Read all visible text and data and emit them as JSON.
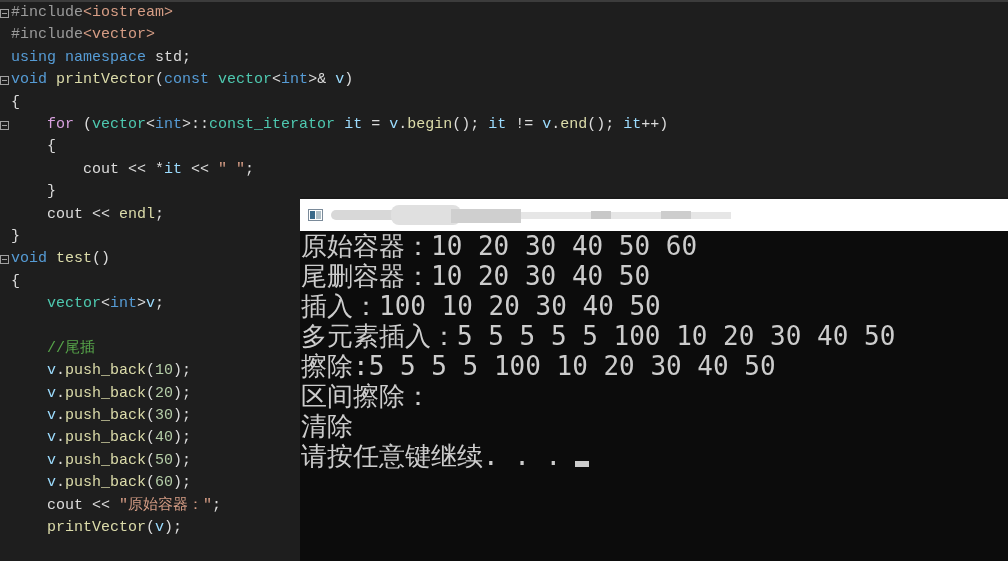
{
  "editor": {
    "lines": [
      {
        "fold": true,
        "tokens": [
          {
            "kind": "pp",
            "text": "#include"
          },
          {
            "kind": "str",
            "text": "<iostream>"
          }
        ]
      },
      {
        "fold": false,
        "tokens": [
          {
            "kind": "pp",
            "text": "#include"
          },
          {
            "kind": "str",
            "text": "<vector>"
          }
        ]
      },
      {
        "fold": false,
        "tokens": [
          {
            "kind": "kw",
            "text": "using "
          },
          {
            "kind": "kw",
            "text": "namespace "
          },
          {
            "kind": "plain",
            "text": "std;"
          }
        ]
      },
      {
        "fold": true,
        "tokens": [
          {
            "kind": "kw",
            "text": "void "
          },
          {
            "kind": "fn",
            "text": "printVector"
          },
          {
            "kind": "plain",
            "text": "("
          },
          {
            "kind": "kw",
            "text": "const "
          },
          {
            "kind": "type",
            "text": "vector"
          },
          {
            "kind": "plain",
            "text": "<"
          },
          {
            "kind": "kw",
            "text": "int"
          },
          {
            "kind": "plain",
            "text": ">& "
          },
          {
            "kind": "var",
            "text": "v"
          },
          {
            "kind": "plain",
            "text": ")"
          }
        ]
      },
      {
        "fold": false,
        "tokens": [
          {
            "kind": "plain",
            "text": "{"
          }
        ]
      },
      {
        "fold": true,
        "tokens": [
          {
            "kind": "ctrl",
            "text": "    for"
          },
          {
            "kind": "plain",
            "text": " ("
          },
          {
            "kind": "type",
            "text": "vector"
          },
          {
            "kind": "plain",
            "text": "<"
          },
          {
            "kind": "kw",
            "text": "int"
          },
          {
            "kind": "plain",
            "text": ">::"
          },
          {
            "kind": "type",
            "text": "const_iterator "
          },
          {
            "kind": "var",
            "text": "it"
          },
          {
            "kind": "plain",
            "text": " = "
          },
          {
            "kind": "var",
            "text": "v"
          },
          {
            "kind": "plain",
            "text": "."
          },
          {
            "kind": "fn",
            "text": "begin"
          },
          {
            "kind": "plain",
            "text": "(); "
          },
          {
            "kind": "var",
            "text": "it"
          },
          {
            "kind": "plain",
            "text": " != "
          },
          {
            "kind": "var",
            "text": "v"
          },
          {
            "kind": "plain",
            "text": "."
          },
          {
            "kind": "fn",
            "text": "end"
          },
          {
            "kind": "plain",
            "text": "(); "
          },
          {
            "kind": "var",
            "text": "it"
          },
          {
            "kind": "plain",
            "text": "++)"
          }
        ]
      },
      {
        "fold": false,
        "tokens": [
          {
            "kind": "plain",
            "text": "    {"
          }
        ]
      },
      {
        "fold": false,
        "tokens": [
          {
            "kind": "plain",
            "text": "        cout << *"
          },
          {
            "kind": "var",
            "text": "it"
          },
          {
            "kind": "plain",
            "text": " << "
          },
          {
            "kind": "str",
            "text": "\" \""
          },
          {
            "kind": "plain",
            "text": ";"
          }
        ]
      },
      {
        "fold": false,
        "tokens": [
          {
            "kind": "plain",
            "text": "    }"
          }
        ]
      },
      {
        "fold": false,
        "tokens": [
          {
            "kind": "plain",
            "text": "    cout << "
          },
          {
            "kind": "fn",
            "text": "endl"
          },
          {
            "kind": "plain",
            "text": ";"
          }
        ]
      },
      {
        "fold": false,
        "tokens": [
          {
            "kind": "plain",
            "text": "}"
          }
        ]
      },
      {
        "fold": true,
        "tokens": [
          {
            "kind": "kw",
            "text": "void "
          },
          {
            "kind": "fn",
            "text": "test"
          },
          {
            "kind": "plain",
            "text": "()"
          }
        ]
      },
      {
        "fold": false,
        "tokens": [
          {
            "kind": "plain",
            "text": "{"
          }
        ]
      },
      {
        "fold": false,
        "tokens": [
          {
            "kind": "type",
            "text": "    vector"
          },
          {
            "kind": "plain",
            "text": "<"
          },
          {
            "kind": "kw",
            "text": "int"
          },
          {
            "kind": "plain",
            "text": ">"
          },
          {
            "kind": "var",
            "text": "v"
          },
          {
            "kind": "plain",
            "text": ";"
          }
        ]
      },
      {
        "fold": false
      },
      {
        "fold": false,
        "tokens": [
          {
            "kind": "comment",
            "text": "    //尾插"
          }
        ]
      },
      {
        "fold": false,
        "tokens": [
          {
            "kind": "var",
            "text": "    v"
          },
          {
            "kind": "plain",
            "text": "."
          },
          {
            "kind": "fn",
            "text": "push_back"
          },
          {
            "kind": "plain",
            "text": "("
          },
          {
            "kind": "num",
            "text": "10"
          },
          {
            "kind": "plain",
            "text": ");"
          }
        ]
      },
      {
        "fold": false,
        "tokens": [
          {
            "kind": "var",
            "text": "    v"
          },
          {
            "kind": "plain",
            "text": "."
          },
          {
            "kind": "fn",
            "text": "push_back"
          },
          {
            "kind": "plain",
            "text": "("
          },
          {
            "kind": "num",
            "text": "20"
          },
          {
            "kind": "plain",
            "text": ");"
          }
        ]
      },
      {
        "fold": false,
        "tokens": [
          {
            "kind": "var",
            "text": "    v"
          },
          {
            "kind": "plain",
            "text": "."
          },
          {
            "kind": "fn",
            "text": "push_back"
          },
          {
            "kind": "plain",
            "text": "("
          },
          {
            "kind": "num",
            "text": "30"
          },
          {
            "kind": "plain",
            "text": ");"
          }
        ]
      },
      {
        "fold": false,
        "tokens": [
          {
            "kind": "var",
            "text": "    v"
          },
          {
            "kind": "plain",
            "text": "."
          },
          {
            "kind": "fn",
            "text": "push_back"
          },
          {
            "kind": "plain",
            "text": "("
          },
          {
            "kind": "num",
            "text": "40"
          },
          {
            "kind": "plain",
            "text": ");"
          }
        ]
      },
      {
        "fold": false,
        "tokens": [
          {
            "kind": "var",
            "text": "    v"
          },
          {
            "kind": "plain",
            "text": "."
          },
          {
            "kind": "fn",
            "text": "push_back"
          },
          {
            "kind": "plain",
            "text": "("
          },
          {
            "kind": "num",
            "text": "50"
          },
          {
            "kind": "plain",
            "text": ");"
          }
        ]
      },
      {
        "fold": false,
        "tokens": [
          {
            "kind": "var",
            "text": "    v"
          },
          {
            "kind": "plain",
            "text": "."
          },
          {
            "kind": "fn",
            "text": "push_back"
          },
          {
            "kind": "plain",
            "text": "("
          },
          {
            "kind": "num",
            "text": "60"
          },
          {
            "kind": "plain",
            "text": ");"
          }
        ]
      },
      {
        "fold": false,
        "tokens": [
          {
            "kind": "plain",
            "text": "    cout << "
          },
          {
            "kind": "str",
            "text": "\"原始容器：\""
          },
          {
            "kind": "plain",
            "text": ";"
          }
        ]
      },
      {
        "fold": false,
        "tokens": [
          {
            "kind": "fn",
            "text": "    printVector"
          },
          {
            "kind": "plain",
            "text": "("
          },
          {
            "kind": "var",
            "text": "v"
          },
          {
            "kind": "plain",
            "text": ");"
          }
        ]
      }
    ]
  },
  "console": {
    "lines": [
      "原始容器：10 20 30 40 50 60",
      "尾删容器：10 20 30 40 50",
      "插入：100 10 20 30 40 50",
      "多元素插入：5 5 5 5 5 100 10 20 30 40 50",
      "擦除:5 5 5 5 100 10 20 30 40 50",
      "区间擦除：",
      "清除",
      "请按任意键继续. . ."
    ]
  }
}
